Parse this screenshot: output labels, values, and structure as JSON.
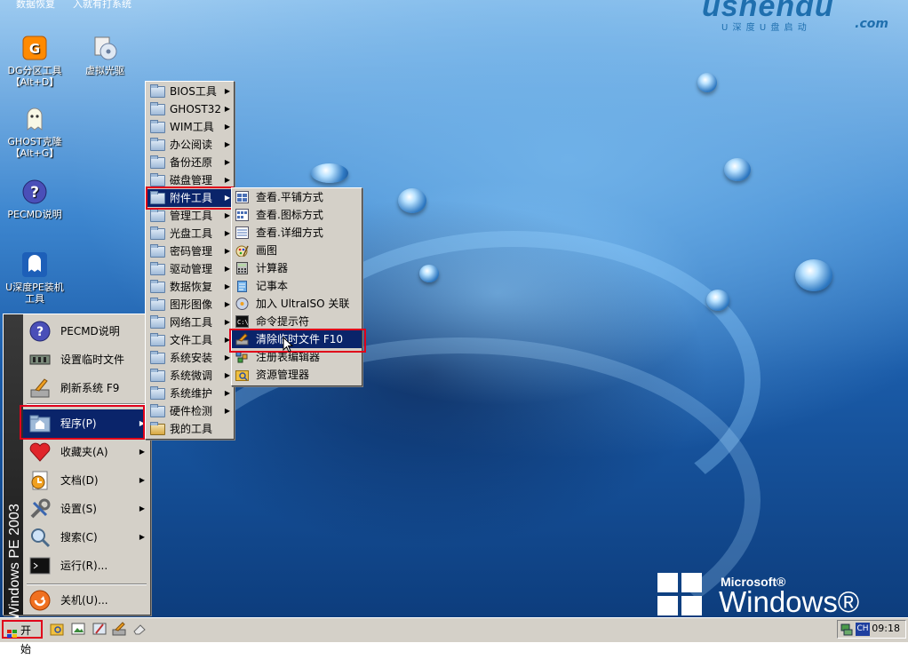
{
  "desktop": {
    "top_labels": [
      "数据恢复",
      "入就有打系统"
    ],
    "brand": {
      "name": "ushendu",
      "sub": "U 深 度 U 盘 启 动",
      "com": ".com"
    },
    "winpe": {
      "ms": "Microsoft®",
      "name": "Windows® PE"
    },
    "icons": [
      {
        "label": "DG分区工具\n【Alt+D】",
        "icon": "diskgenius-icon"
      },
      {
        "label": "虚拟光驱",
        "icon": "virtual-drive-icon"
      },
      {
        "label": "GHOST克隆\n【Alt+G】",
        "icon": "ghost-icon"
      },
      {
        "label": "PECMD说明",
        "icon": "help-icon"
      },
      {
        "label": "U深度PE装机\n工具",
        "icon": "pe-installer-icon"
      }
    ]
  },
  "start_menu": {
    "sidebar_text": "Windows PE 2003",
    "items": [
      {
        "label": "PECMD说明",
        "icon": "help-icon"
      },
      {
        "label": "设置临时文件",
        "icon": "memory-chip-icon"
      },
      {
        "label": "刷新系统 F9",
        "icon": "refresh-brush-icon"
      },
      {
        "label": "程序(P)",
        "icon": "programs-folder-icon",
        "submenu": true,
        "highlighted": true
      },
      {
        "label": "收藏夹(A)",
        "icon": "favorites-heart-icon",
        "submenu": true
      },
      {
        "label": "文档(D)",
        "icon": "documents-icon",
        "submenu": true
      },
      {
        "label": "设置(S)",
        "icon": "settings-tools-icon",
        "submenu": true
      },
      {
        "label": "搜索(C)",
        "icon": "search-icon",
        "submenu": true
      },
      {
        "label": "运行(R)...",
        "icon": "run-console-icon"
      },
      {
        "label": "关机(U)...",
        "icon": "shutdown-icon"
      }
    ]
  },
  "programs_menu": {
    "items": [
      "BIOS工具",
      "GHOST32",
      "WIM工具",
      "办公阅读",
      "备份还原",
      "磁盘管理",
      "附件工具",
      "管理工具",
      "光盘工具",
      "密码管理",
      "驱动管理",
      "数据恢复",
      "图形图像",
      "网络工具",
      "文件工具",
      "系统安装",
      "系统微调",
      "系统维护",
      "硬件检测",
      "我的工具"
    ],
    "highlighted": "附件工具"
  },
  "accessories_menu": {
    "items": [
      {
        "label": "查看.平铺方式",
        "icon": "view-tile-icon"
      },
      {
        "label": "查看.图标方式",
        "icon": "view-icons-icon"
      },
      {
        "label": "查看.详细方式",
        "icon": "view-details-icon"
      },
      {
        "label": "画图",
        "icon": "paint-icon"
      },
      {
        "label": "计算器",
        "icon": "calculator-icon"
      },
      {
        "label": "记事本",
        "icon": "notepad-icon"
      },
      {
        "label": "加入 UltraISO 关联",
        "icon": "ultraiso-icon"
      },
      {
        "label": "命令提示符",
        "icon": "cmd-icon"
      },
      {
        "label": "清除临时文件 F10",
        "icon": "clean-temp-icon"
      },
      {
        "label": "注册表编辑器",
        "icon": "regedit-icon"
      },
      {
        "label": "资源管理器",
        "icon": "explorer-icon"
      }
    ],
    "highlighted": "清除临时文件 F10"
  },
  "taskbar": {
    "start_label": "开始",
    "lang": "CH",
    "clock": "09:18"
  }
}
